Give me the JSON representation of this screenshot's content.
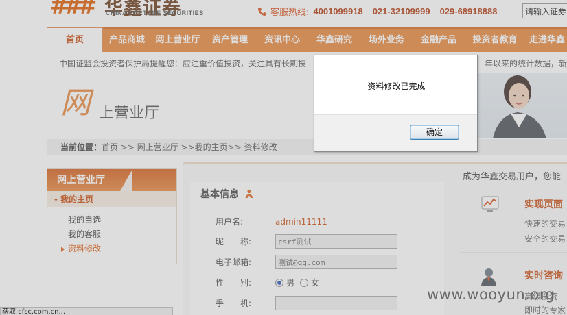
{
  "header": {
    "logo_cn": "华鑫证券",
    "logo_en": "CHINA FORTUNE SECURITIES",
    "hotline_label": "客服热线:",
    "hotline_numbers": [
      "4001099918",
      "021-32109999",
      "029-68918888"
    ],
    "search_value": "请输入证券"
  },
  "nav": {
    "items": [
      "首页",
      "产品商城",
      "网上营业厅",
      "资产管理",
      "资讯中心",
      "华鑫研究",
      "场外业务",
      "金融产品",
      "投资者教育",
      "走进华鑫"
    ],
    "active_index": 0
  },
  "ticker": {
    "text_left": "中国证监会投资者保护局提醒您：应注重价值投资，关注具有长期投",
    "text_right": "年以来的统计数据，新股"
  },
  "banner": {
    "big_char": "网",
    "title": "上营业厅"
  },
  "breadcrumb": {
    "label": "当前位置：",
    "path": "首页 >> 网上营业厅 >>我的主页>> 资料修改"
  },
  "sidebar": {
    "title": "网上营业厅",
    "section": "- 我的主页",
    "items": [
      "我的自选",
      "我的客服",
      "资料修改"
    ],
    "active_index": 2
  },
  "basic_info": {
    "title": "基本信息",
    "username_label": "用户名:",
    "username_value": "admin11111",
    "nickname_label": "昵　　称:",
    "nickname_value": "csrf测试",
    "email_label": "电子邮箱:",
    "email_value": "测试@qq.com",
    "gender_label": "性　　别:",
    "gender_male": "男",
    "gender_female": "女",
    "gender_selected": "男",
    "phone_label": "手　　机:",
    "phone_value": ""
  },
  "right_col": {
    "promo": "成为华鑫交易用户，您能",
    "block1_title": "实现页面",
    "block1_desc1": "快速的交易",
    "block1_desc2": "安全的交易",
    "block2_title": "实时咨询",
    "block2_desc1": "高级投资",
    "block2_desc2": "即时的专家"
  },
  "statusbar": {
    "text": "获取 cfsc.com.cn..."
  },
  "watermark": "www.wooyun.org",
  "dialog": {
    "message": "资料修改已完成",
    "ok_label": "确定"
  },
  "colors": {
    "brand_orange": "#e8863c",
    "brand_dark_orange": "#c94c0f",
    "dialog_focus": "#3c7fb1"
  }
}
